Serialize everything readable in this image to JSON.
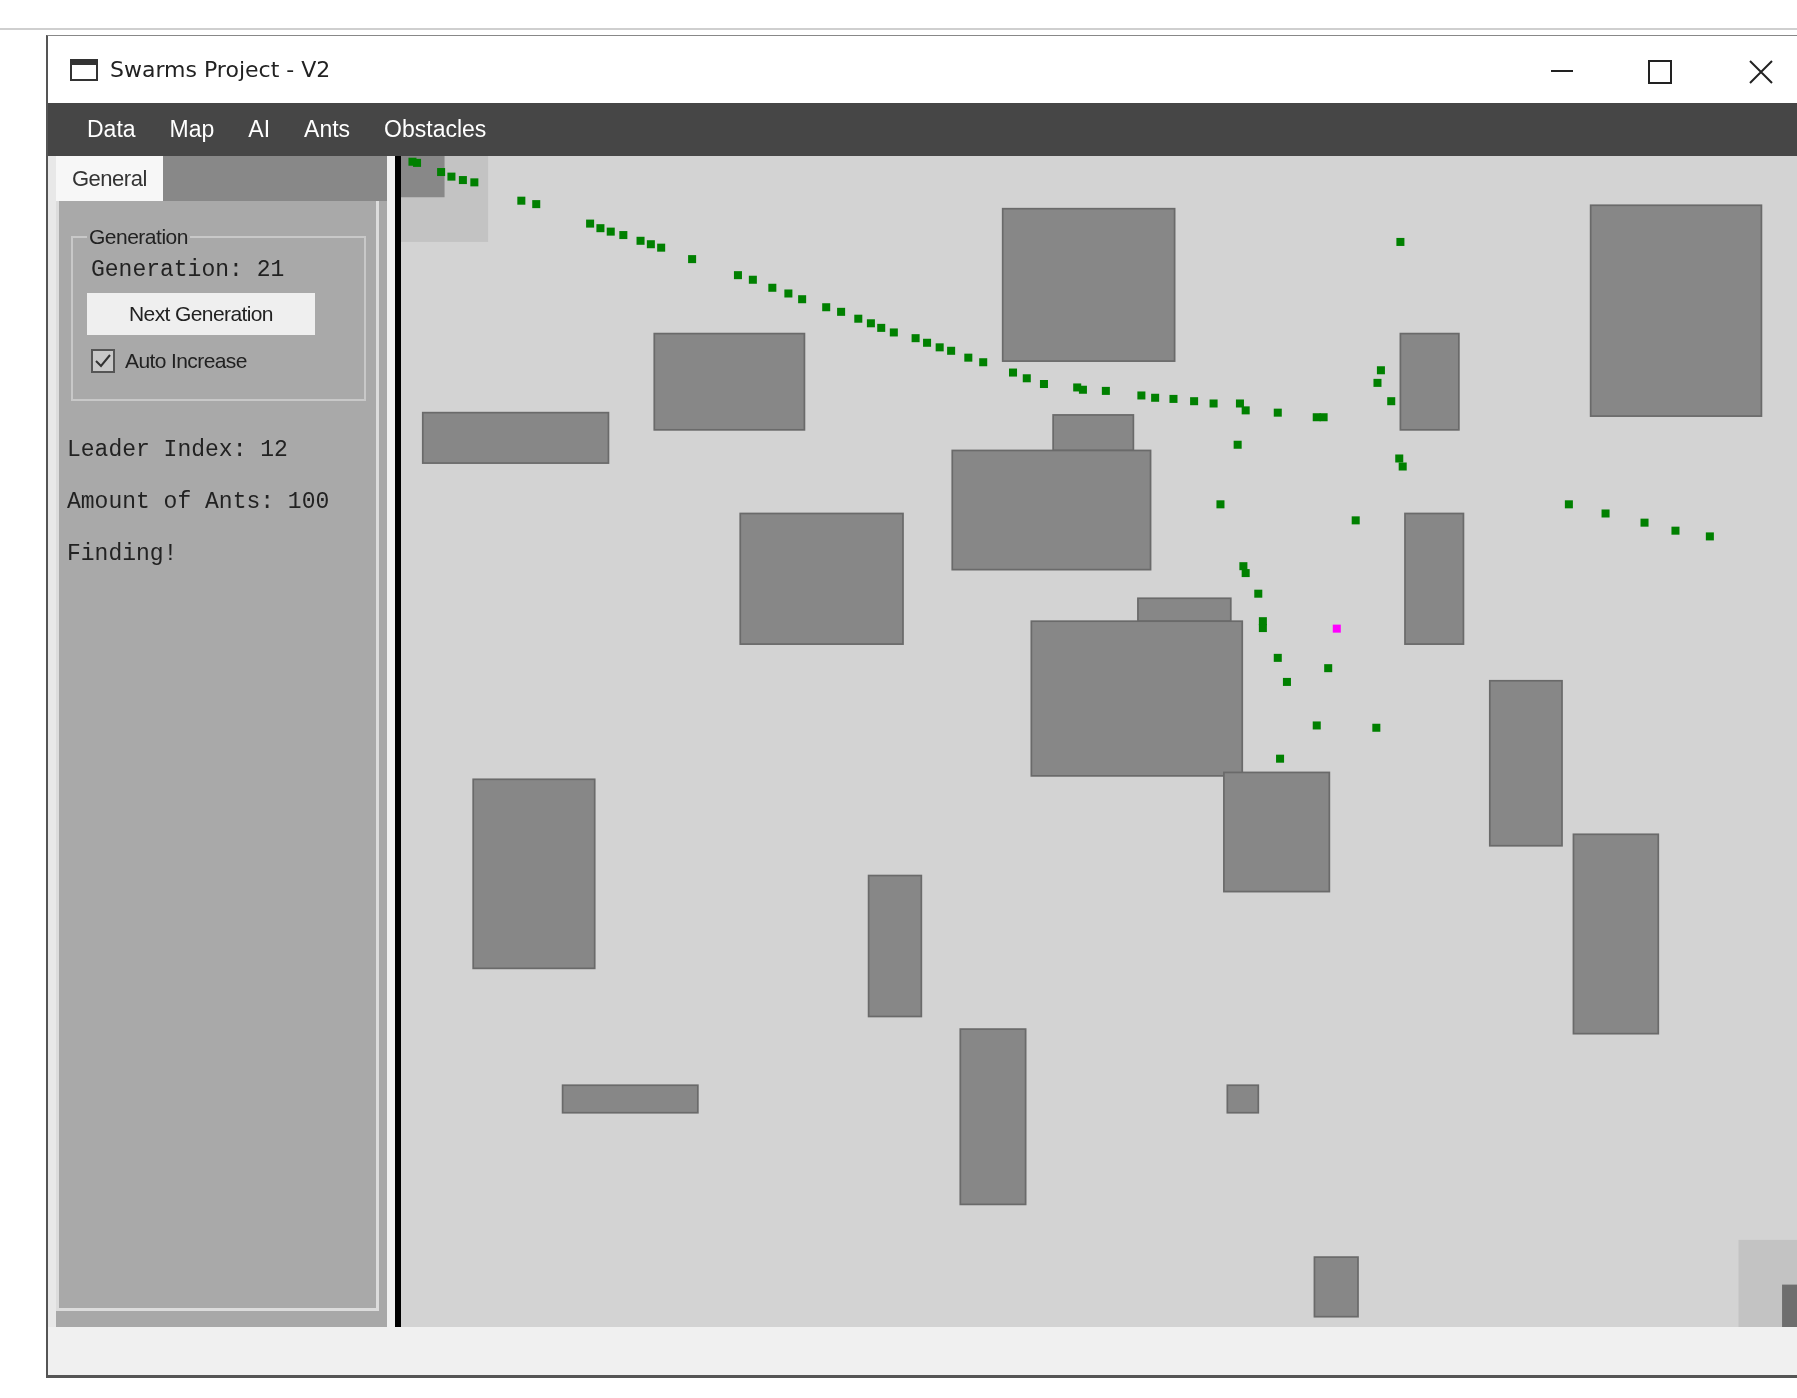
{
  "window": {
    "title": "Swarms Project - V2"
  },
  "menu": [
    "Data",
    "Map",
    "AI",
    "Ants",
    "Obstacles"
  ],
  "side_panel": {
    "tabs": [
      {
        "label": "General",
        "selected": true
      }
    ],
    "group": {
      "title": "Generation",
      "generation": "Generation: 21",
      "button": "Next Generation",
      "checkbox": {
        "label": "Auto Increase",
        "checked": true
      }
    },
    "labels": [
      "Leader Index: 12",
      "Amount of Ants: 100",
      "Finding!"
    ]
  }
}
